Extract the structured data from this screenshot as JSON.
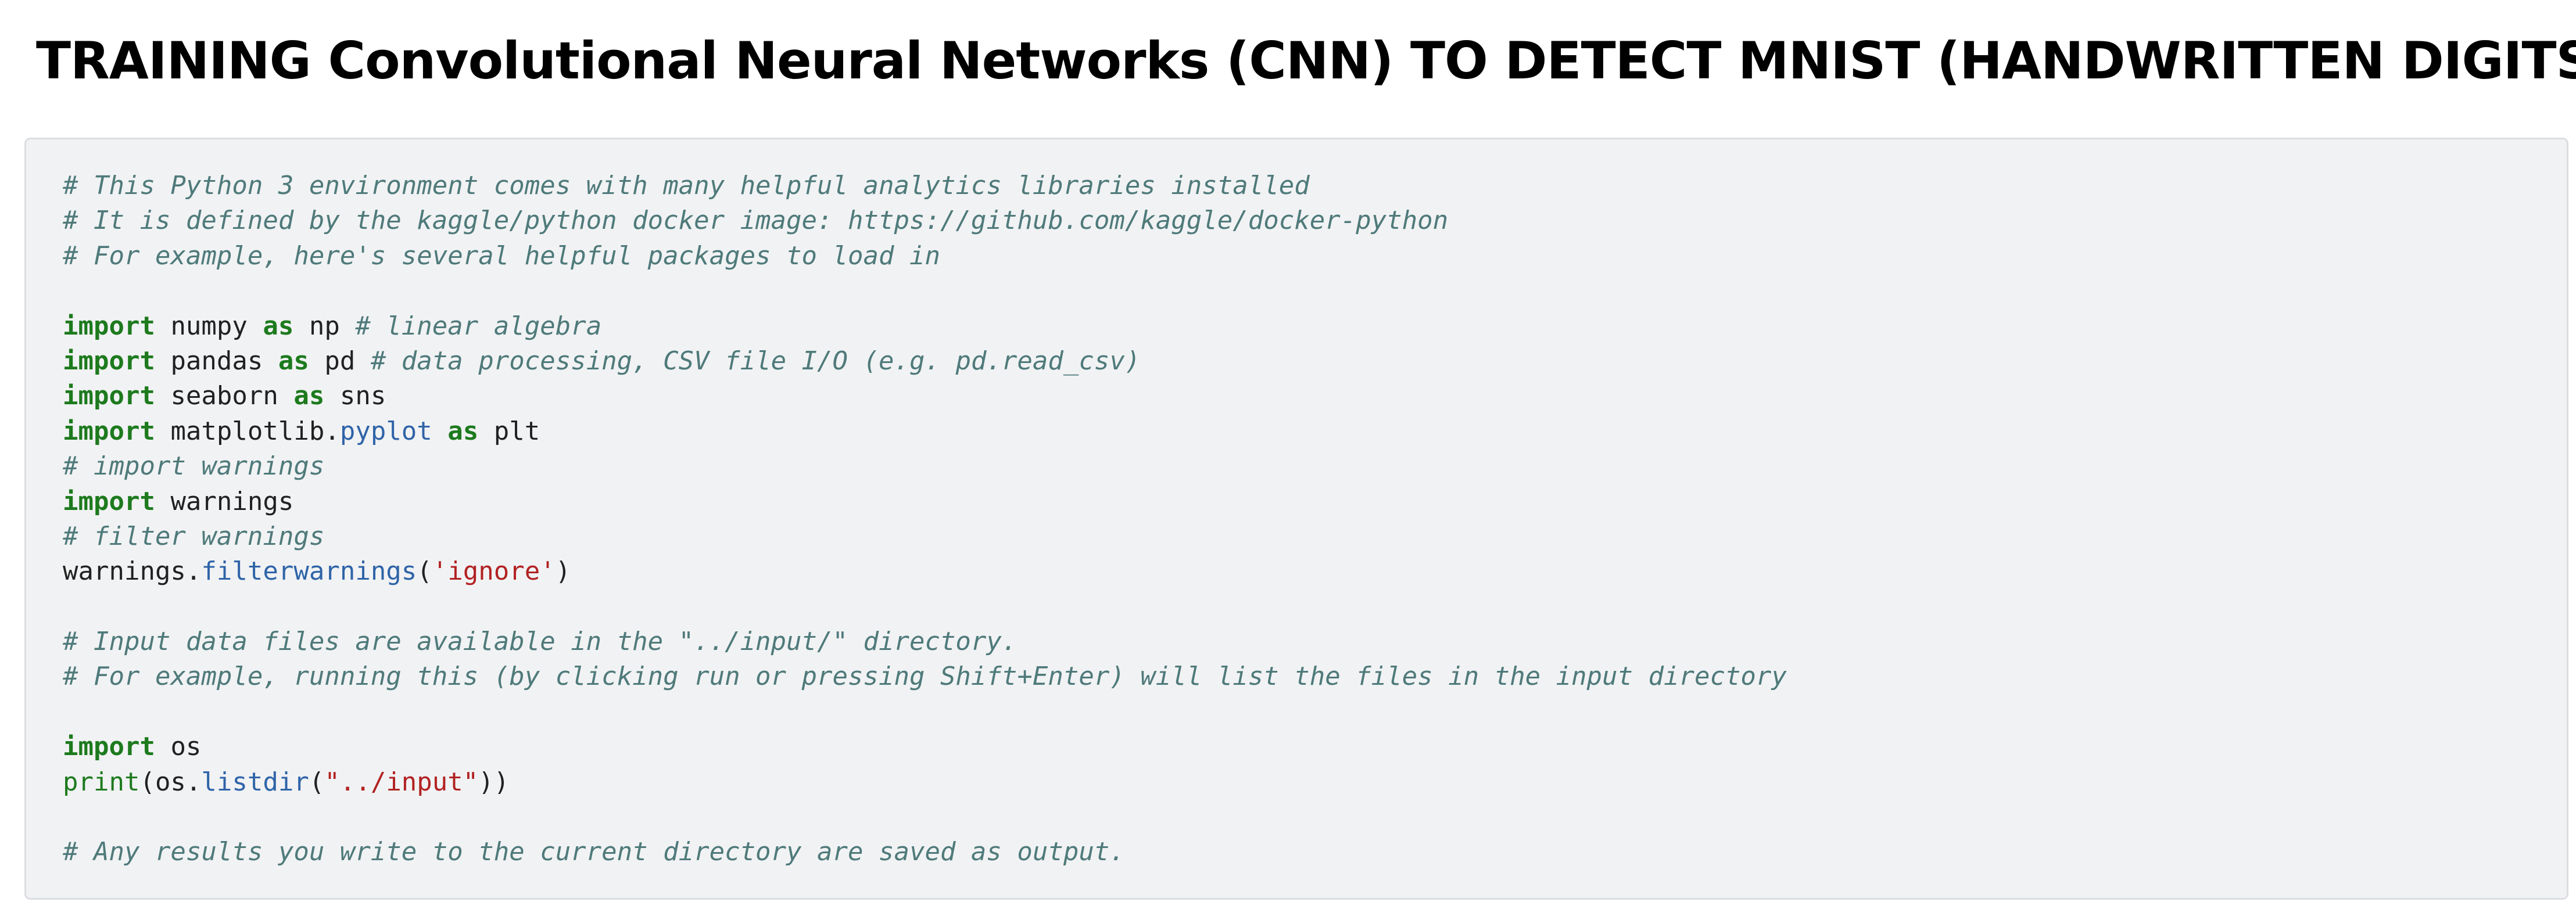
{
  "title": "TRAINING Convolutional Neural Networks (CNN) TO DETECT MNIST (HANDWRITTEN DIGITS)",
  "colors": {
    "comment": "#4f7a7a",
    "keyword": "#1d7a1d",
    "attribute": "#2f64a8",
    "string": "#b22222",
    "text": "#212121",
    "cell_background": "#f1f2f4",
    "cell_border": "#dcdee1"
  },
  "code_cell": {
    "lines": [
      [
        {
          "t": "# This Python 3 environment comes with many helpful analytics libraries installed",
          "k": "comment"
        }
      ],
      [
        {
          "t": "# It is defined by the kaggle/python docker image: https://github.com/kaggle/docker-python",
          "k": "comment"
        }
      ],
      [
        {
          "t": "# For example, here's several helpful packages to load in",
          "k": "comment"
        }
      ],
      [],
      [
        {
          "t": "import",
          "k": "keyword"
        },
        {
          "t": " numpy ",
          "k": "name"
        },
        {
          "t": "as",
          "k": "keyword"
        },
        {
          "t": " np ",
          "k": "name"
        },
        {
          "t": "# linear algebra",
          "k": "comment"
        }
      ],
      [
        {
          "t": "import",
          "k": "keyword"
        },
        {
          "t": " pandas ",
          "k": "name"
        },
        {
          "t": "as",
          "k": "keyword"
        },
        {
          "t": " pd ",
          "k": "name"
        },
        {
          "t": "# data processing, CSV file I/O (e.g. pd.read_csv)",
          "k": "comment"
        }
      ],
      [
        {
          "t": "import",
          "k": "keyword"
        },
        {
          "t": " seaborn ",
          "k": "name"
        },
        {
          "t": "as",
          "k": "keyword"
        },
        {
          "t": " sns",
          "k": "name"
        }
      ],
      [
        {
          "t": "import",
          "k": "keyword"
        },
        {
          "t": " matplotlib.",
          "k": "name"
        },
        {
          "t": "pyplot",
          "k": "attr"
        },
        {
          "t": " ",
          "k": "name"
        },
        {
          "t": "as",
          "k": "keyword"
        },
        {
          "t": " plt",
          "k": "name"
        }
      ],
      [
        {
          "t": "# import warnings",
          "k": "comment"
        }
      ],
      [
        {
          "t": "import",
          "k": "keyword"
        },
        {
          "t": " warnings",
          "k": "name"
        }
      ],
      [
        {
          "t": "# filter warnings",
          "k": "comment"
        }
      ],
      [
        {
          "t": "warnings.",
          "k": "name"
        },
        {
          "t": "filterwarnings",
          "k": "attr"
        },
        {
          "t": "(",
          "k": "punct"
        },
        {
          "t": "'ignore'",
          "k": "string"
        },
        {
          "t": ")",
          "k": "punct"
        }
      ],
      [],
      [
        {
          "t": "# Input data files are available in the \"../input/\" directory.",
          "k": "comment"
        }
      ],
      [
        {
          "t": "# For example, running this (by clicking run or pressing Shift+Enter) will list the files in the input directory",
          "k": "comment"
        }
      ],
      [],
      [
        {
          "t": "import",
          "k": "keyword"
        },
        {
          "t": " os",
          "k": "name"
        }
      ],
      [
        {
          "t": "print",
          "k": "builtin"
        },
        {
          "t": "(os.",
          "k": "name"
        },
        {
          "t": "listdir",
          "k": "attr"
        },
        {
          "t": "(",
          "k": "punct"
        },
        {
          "t": "\"../input\"",
          "k": "string"
        },
        {
          "t": "))",
          "k": "punct"
        }
      ],
      [],
      [
        {
          "t": "# Any results you write to the current directory are saved as output.",
          "k": "comment"
        }
      ]
    ]
  }
}
